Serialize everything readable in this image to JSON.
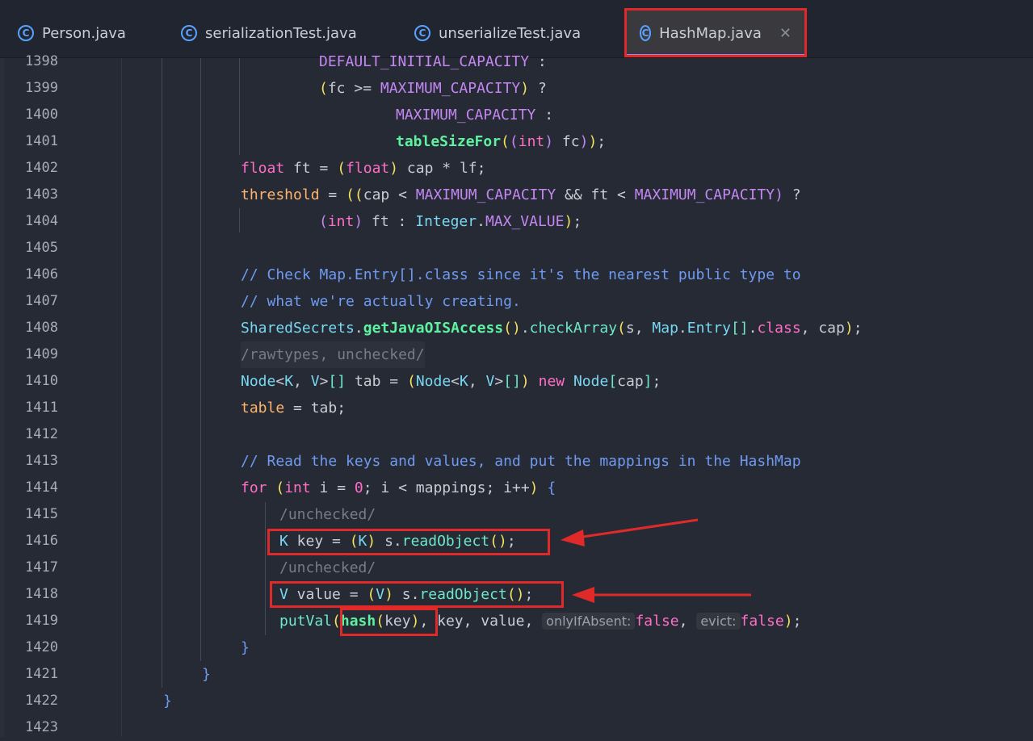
{
  "tabs": [
    {
      "label": "Person.java",
      "icon": "class-icon",
      "active": false
    },
    {
      "label": "serializationTest.java",
      "icon": "class-icon",
      "active": false
    },
    {
      "label": "unserializeTest.java",
      "icon": "class-icon",
      "active": false
    },
    {
      "label": "HashMap.java",
      "icon": "class-icon",
      "active": true
    }
  ],
  "tab_icon_letter": "C",
  "close_symbol": "✕",
  "line_numbers": [
    "1398",
    "1399",
    "1400",
    "1401",
    "1402",
    "1403",
    "1404",
    "1405",
    "1406",
    "1407",
    "1408",
    "1409",
    "1410",
    "1411",
    "1412",
    "1413",
    "1414",
    "1415",
    "1416",
    "1417",
    "1418",
    "1419",
    "1420",
    "1421",
    "1422",
    "1423"
  ],
  "code": {
    "l1398": {
      "a": "DEFAULT_INITIAL_CAPACITY",
      "b": " :"
    },
    "l1399": {
      "a": "(",
      "b": "fc >= ",
      "c": "MAXIMUM_CAPACITY",
      "d": ")",
      "e": " ?"
    },
    "l1400": {
      "a": "MAXIMUM_CAPACITY",
      "b": " :"
    },
    "l1401": {
      "a": "tableSizeFor",
      "b": "(",
      "c": "(",
      "d": "int",
      "e": ")",
      "f": " fc",
      "g": ")",
      "h": ")",
      "i": ";"
    },
    "l1402": {
      "a": "float",
      "b": " ft = ",
      "c": "(",
      "d": "float",
      "e": ")",
      "f": " cap * lf;"
    },
    "l1403": {
      "a": "threshold",
      "b": " = ",
      "c": "((",
      "d": "cap < ",
      "e": "MAXIMUM_CAPACITY",
      "f": " && ft < ",
      "g": "MAXIMUM_CAPACITY",
      "h": ")",
      "i": " ?"
    },
    "l1404": {
      "a": "(",
      "b": "int",
      "c": ")",
      "d": " ft : ",
      "e": "Integer",
      "f": ".",
      "g": "MAX_VALUE",
      "h": ")",
      "i": ";"
    },
    "l1406": {
      "a": "// Check Map.Entry[].class since it's the nearest public type to"
    },
    "l1407": {
      "a": "// what we're actually creating."
    },
    "l1408": {
      "a": "SharedSecrets",
      "b": ".",
      "c": "getJavaOISAccess",
      "d": "()",
      "e": ".",
      "f": "checkArray",
      "g": "(",
      "h": "s, ",
      "i": "Map",
      "j": ".",
      "k": "Entry",
      "l": "[]",
      "m": ".",
      "n": "class",
      "o": ", cap",
      "p": ")",
      "q": ";"
    },
    "l1409": {
      "a": "/rawtypes, unchecked/"
    },
    "l1410": {
      "a": "Node",
      "b": "<",
      "c": "K",
      "d": ", ",
      "e": "V",
      "f": ">",
      "g": "[]",
      "h": " tab = ",
      "i": "(",
      "j": "Node",
      "k": "<",
      "l": "K",
      "m": ", ",
      "n": "V",
      "o": ">",
      "p": "[]",
      "q": ")",
      "r": " new ",
      "s": "Node",
      "t": "[",
      "u": "cap",
      "v": "]",
      "w": ";"
    },
    "l1411": {
      "a": "table",
      "b": " = tab;"
    },
    "l1413": {
      "a": "// Read the keys and values, and put the mappings in the HashMap"
    },
    "l1414": {
      "a": "for",
      "b": " ",
      "c": "(",
      "d": "int",
      "e": " i = ",
      "f": "0",
      "g": "; i < mappings; i++",
      "h": ")",
      "i": " {"
    },
    "l1415": {
      "a": "/unchecked/"
    },
    "l1416": {
      "a": "K",
      "b": " key = ",
      "c": "(",
      "d": "K",
      "e": ")",
      "f": " s.",
      "g": "readObject",
      "h": "()",
      "i": ";"
    },
    "l1417": {
      "a": "/unchecked/"
    },
    "l1418": {
      "a": "V",
      "b": " value = ",
      "c": "(",
      "d": "V",
      "e": ")",
      "f": " s.",
      "g": "readObject",
      "h": "()",
      "i": ";"
    },
    "l1419": {
      "a": "putVal",
      "b": "(",
      "c": "hash",
      "d": "(",
      "e": "key",
      "f": ")",
      "g": ", key, value, ",
      "h": "onlyIfAbsent:",
      "i": "false",
      "j": ", ",
      "k": "evict:",
      "l": "false",
      "m": ")",
      "n": ";"
    },
    "l1420": {
      "a": "}"
    },
    "l1421": {
      "a": "}"
    },
    "l1422": {
      "a": "}"
    }
  },
  "colors": {
    "background": "#262a35",
    "highlight_red": "#e02a2a",
    "active_tab_underline": "#b27cf0"
  }
}
